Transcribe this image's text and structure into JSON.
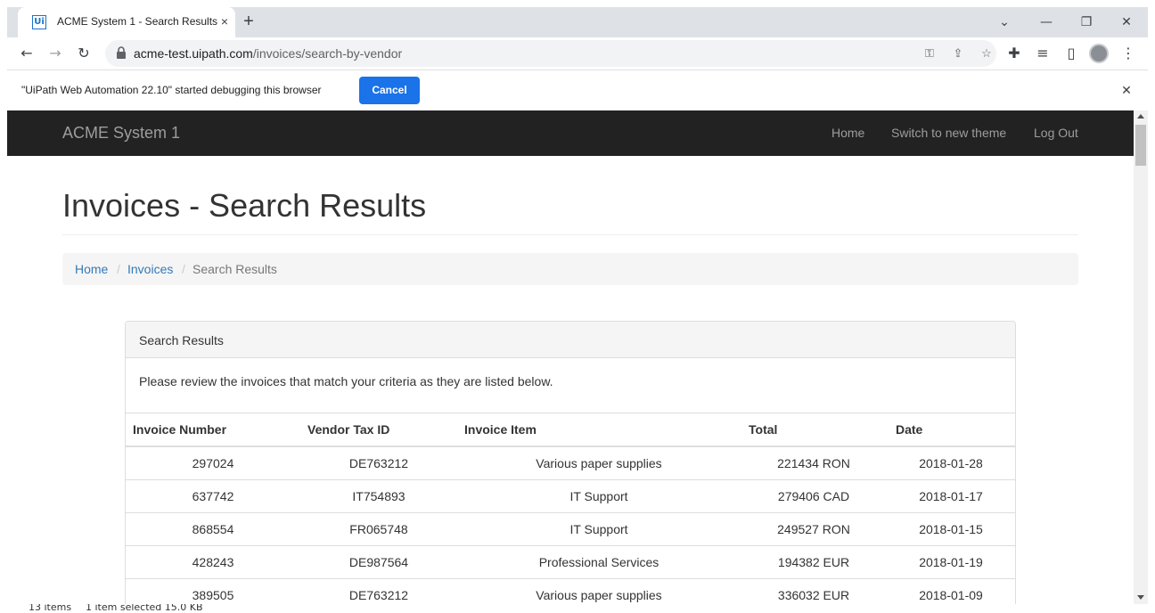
{
  "browser": {
    "tab": {
      "favicon": "Ui",
      "title": "ACME System 1 - Search Results",
      "close_icon": "×"
    },
    "new_tab_icon": "+",
    "window_controls": {
      "tablist": "⌄",
      "minimize": "—",
      "restore": "❐",
      "close": "✕"
    },
    "nav": {
      "back": "←",
      "forward": "→",
      "reload": "↻"
    },
    "address": {
      "host": "acme-test.uipath.com",
      "path": "/invoices/search-by-vendor"
    },
    "omnibox_icons": {
      "key": "⚿",
      "share": "⇪",
      "star": "☆"
    },
    "toolbar_icons": {
      "extensions": "✚",
      "media": "≡",
      "sidepanel": "▯",
      "menu": "⋮"
    }
  },
  "debug_banner": {
    "message": "\"UiPath Web Automation 22.10\" started debugging this browser",
    "cancel_label": "Cancel",
    "close_icon": "✕"
  },
  "site": {
    "brand": "ACME System 1",
    "nav": [
      "Home",
      "Switch to new theme",
      "Log Out"
    ]
  },
  "page": {
    "title": "Invoices - Search Results",
    "breadcrumb": [
      "Home",
      "Invoices",
      "Search Results"
    ],
    "breadcrumb_separator": "/"
  },
  "panel": {
    "heading": "Search Results",
    "body": "Please review the invoices that match your criteria as they are listed below.",
    "columns": [
      "Invoice Number",
      "Vendor Tax ID",
      "Invoice Item",
      "Total",
      "Date"
    ],
    "rows": [
      [
        "297024",
        "DE763212",
        "Various paper supplies",
        "221434 RON",
        "2018-01-28"
      ],
      [
        "637742",
        "IT754893",
        "IT Support",
        "279406 CAD",
        "2018-01-17"
      ],
      [
        "868554",
        "FR065748",
        "IT Support",
        "249527 RON",
        "2018-01-15"
      ],
      [
        "428243",
        "DE987564",
        "Professional Services",
        "194382 EUR",
        "2018-01-19"
      ],
      [
        "389505",
        "DE763212",
        "Various paper supplies",
        "336032 EUR",
        "2018-01-09"
      ]
    ]
  },
  "statusbar": {
    "items": "13 items",
    "selected": "1 item selected  15.0 KB"
  }
}
